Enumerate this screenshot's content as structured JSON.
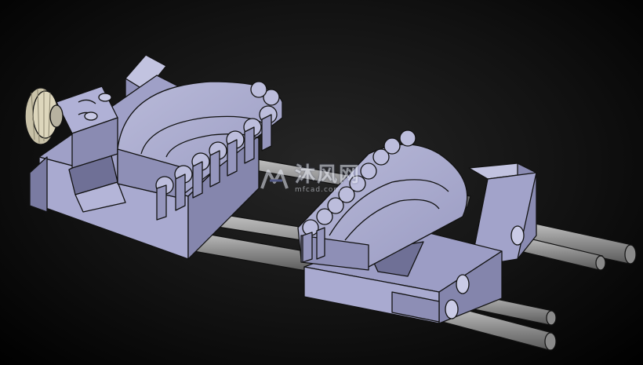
{
  "watermark": {
    "text": "沐风网",
    "url": "mfcad.com",
    "logo_icon": "mf-logo-icon"
  },
  "colors": {
    "background": "#000000",
    "part_face": "#a7a8cc",
    "part_dark": "#7f80a6",
    "part_light": "#c2c3e0",
    "edge": "#141414",
    "rod": "#9a9a9a"
  }
}
